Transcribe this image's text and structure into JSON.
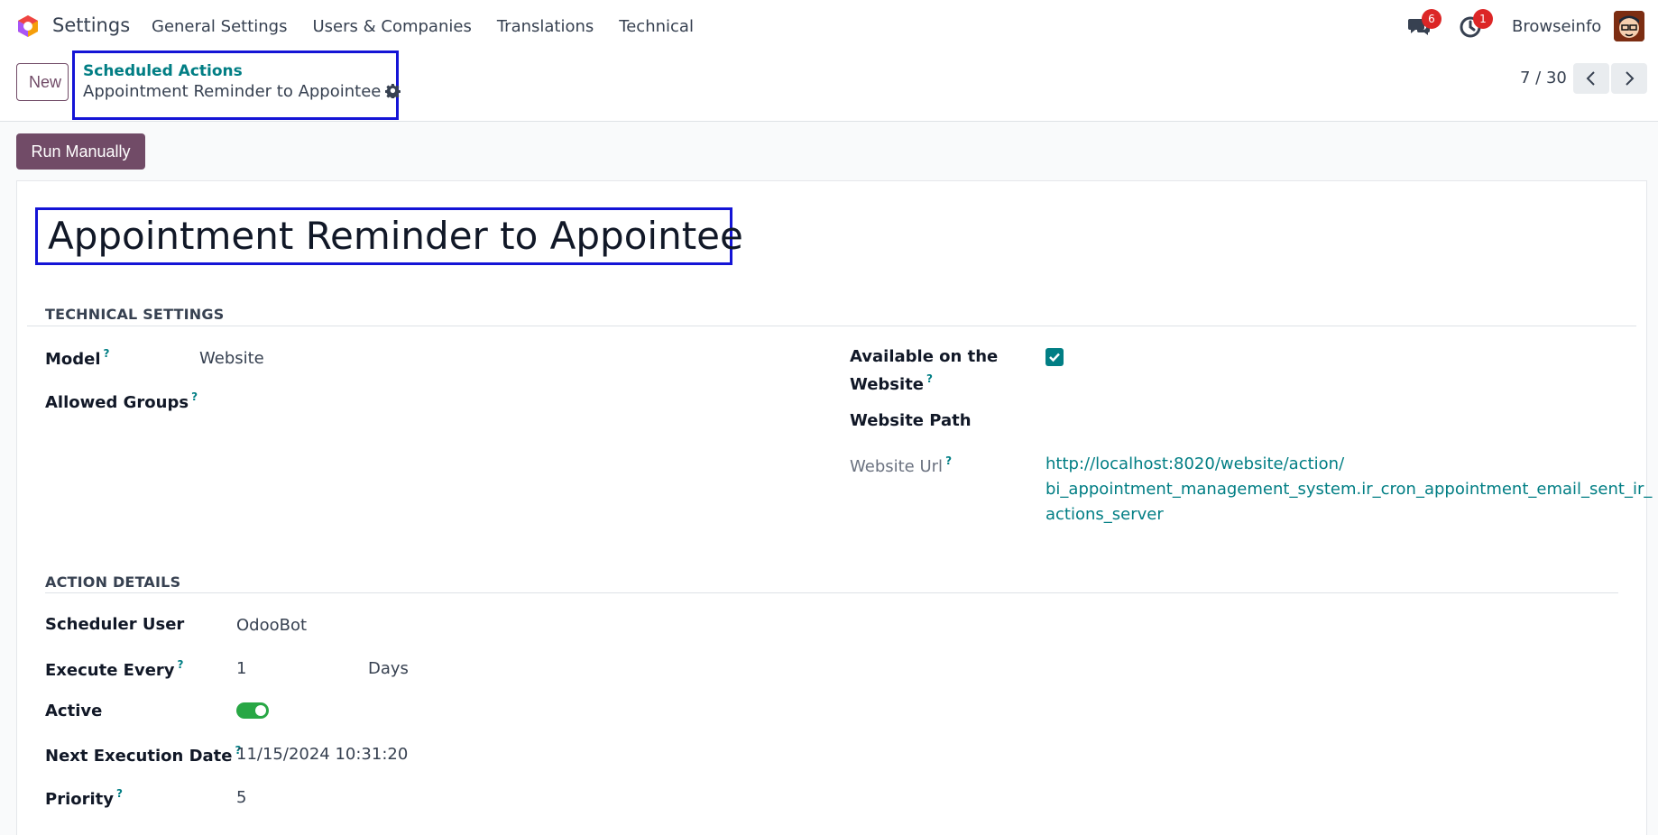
{
  "navbar": {
    "app_name": "Settings",
    "menu": [
      "General Settings",
      "Users & Companies",
      "Translations",
      "Technical"
    ],
    "messages_count": "6",
    "activities_count": "1",
    "user_name": "Browseinfo"
  },
  "control_panel": {
    "new_label": "New",
    "breadcrumb_parent": "Scheduled Actions",
    "breadcrumb_current": "Appointment Reminder to Appointee",
    "pager": "7 / 30"
  },
  "actions": {
    "run_manually": "Run Manually"
  },
  "record": {
    "title": "Appointment Reminder to Appointee"
  },
  "technical_settings": {
    "heading": "TECHNICAL SETTINGS",
    "model_label": "Model",
    "model_value": "Website",
    "allowed_groups_label": "Allowed Groups",
    "available_on_website_label_1": "Available on the",
    "available_on_website_label_2": "Website",
    "available_on_website": true,
    "website_path_label": "Website Path",
    "website_url_label": "Website Url",
    "website_url_line1": "http://localhost:8020/website/action/",
    "website_url_line2": "bi_appointment_management_system.ir_cron_appointment_email_sent_ir_",
    "website_url_line3": "actions_server"
  },
  "action_details": {
    "heading": "ACTION DETAILS",
    "scheduler_user_label": "Scheduler User",
    "scheduler_user_value": "OdooBot",
    "execute_every_label": "Execute Every",
    "execute_every_number": "1",
    "execute_every_unit": "Days",
    "active_label": "Active",
    "active": true,
    "next_execution_label": "Next Execution Date",
    "next_execution_value": "11/15/2024 10:31:20",
    "priority_label": "Priority",
    "priority_value": "5"
  },
  "help_marker": "?",
  "colors": {
    "brand": "#714b67",
    "accent": "#017e84",
    "highlight_box": "#1414d6",
    "badge": "#dc2626",
    "toggle_on": "#28a745"
  },
  "icons": [
    "odoo-logo-icon",
    "chat-icon",
    "activity-clock-icon",
    "gear-icon",
    "chevron-left-icon",
    "chevron-right-icon",
    "check-icon"
  ]
}
